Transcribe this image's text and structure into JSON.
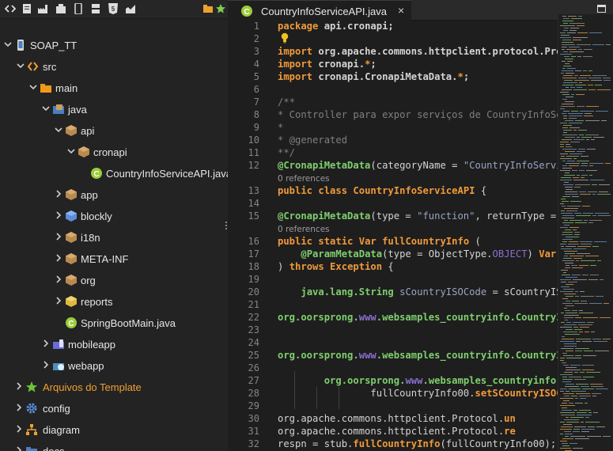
{
  "toolbar": {
    "icons": [
      "code-icon",
      "document-icon",
      "factory-icon",
      "building-icon",
      "mobile-icon",
      "dashboard-icon",
      "html5-icon",
      "chart-icon",
      "folder-icon",
      "star-icon"
    ]
  },
  "tree": {
    "project": "SOAP_TT",
    "src": "src",
    "main": "main",
    "java": "java",
    "api": "api",
    "cronapi": "cronapi",
    "file_api": "CountryInfoServiceAPI.java",
    "app": "app",
    "blockly": "blockly",
    "i18n": "i18n",
    "meta_inf": "META-INF",
    "org": "org",
    "reports": "reports",
    "file_boot": "SpringBootMain.java",
    "mobileapp": "mobileapp",
    "webapp": "webapp",
    "templates": "Arquivos do Template",
    "config": "config",
    "diagram": "diagram",
    "docs": "docs"
  },
  "editor": {
    "tab_label": "CountryInfoServiceAPI.java",
    "close_glyph": "×"
  },
  "code": {
    "refs": "0 references",
    "l1_kw": "package",
    "l1_rest": " api.cronapi;",
    "l3_kw": "import",
    "l3_rest": " org.apache.commons.httpclient.protocol.Prot",
    "l4_kw": "import",
    "l4_rest": " cronapi.",
    "l4_star": "*",
    "l4_end": ";",
    "l5_kw": "import",
    "l5_rest": " cronapi.CronapiMetaData.",
    "l5_star": "*",
    "l5_end": ";",
    "l7": "/**",
    "l8": "* Controller para expor serviços de CountryInfoSer",
    "l9": "*",
    "l10": "* @generated",
    "l11": "**/",
    "l12_an": "@CronapiMetaData",
    "l12_rest": "(categoryName = ",
    "l12_str": "\"CountryInfoServi",
    "l13_kw": "public class",
    "l13_cls": "CountryInfoServiceAPI",
    "l13_end": " {",
    "l15_an": "@CronapiMetaData",
    "l15_rest": "(type = ",
    "l15_str": "\"function\"",
    "l15_tail": ", returnType = (",
    "l16_kw": "public static",
    "l16_ty": "Var",
    "l16_fn": "fullCountryInfo",
    "l16_end": " (",
    "l17_an": "@ParamMetaData",
    "l17_rest": "(type = ObjectType.",
    "l17_obj": "OBJECT",
    "l17_end": ") ",
    "l17_var": "Var",
    "l18_a": ") ",
    "l18_kw": "throws",
    "l18_ex": " Exception",
    "l18_end": " {",
    "l20_ty": "java.lang.String",
    "l20_id": "sCountryISOCode",
    "l20_rest": " = sCountryISO",
    "l22_a": "org.oorsprong.",
    "l22_w": "www",
    "l22_b": ".websamples_countryinfo.CountryIn",
    "l25_a": "org.oorsprong.",
    "l25_w": "www",
    "l25_b": ".websamples_countryinfo.CountryIn",
    "l27_a": "org.oorsprong.",
    "l27_w": "www",
    "l27_b": ".websamples_countryinfo.C",
    "l28_a": "fullCountryInfo00.",
    "l28_b": "setSCountryISOCo",
    "l30_a": "org.apache.commons.httpclient.Protocol.",
    "l30_b": "un",
    "l31_a": "org.apache.commons.httpclient.Protocol.",
    "l31_b": "re",
    "l32_a": "respn = stub.",
    "l32_b": "fullCountryInfo",
    "l32_c": "(fullCountryInfo00);"
  },
  "line_numbers": [
    "1",
    "2",
    "3",
    "4",
    "5",
    "6",
    "7",
    "8",
    "9",
    "10",
    "11",
    "12",
    "13",
    "14",
    "15",
    "16",
    "17",
    "18",
    "19",
    "20",
    "21",
    "22",
    "23",
    "24",
    "25",
    "26",
    "27",
    "28",
    "29",
    "30",
    "31",
    "32"
  ],
  "colors": {
    "accent_orange": "#f09a3a",
    "annotation_green": "#7fcf6e",
    "string_blue": "#9ba4c4",
    "comment_gray": "#7f7f7f",
    "panel_bg": "#232323",
    "editor_bg": "#1e1e1e"
  }
}
